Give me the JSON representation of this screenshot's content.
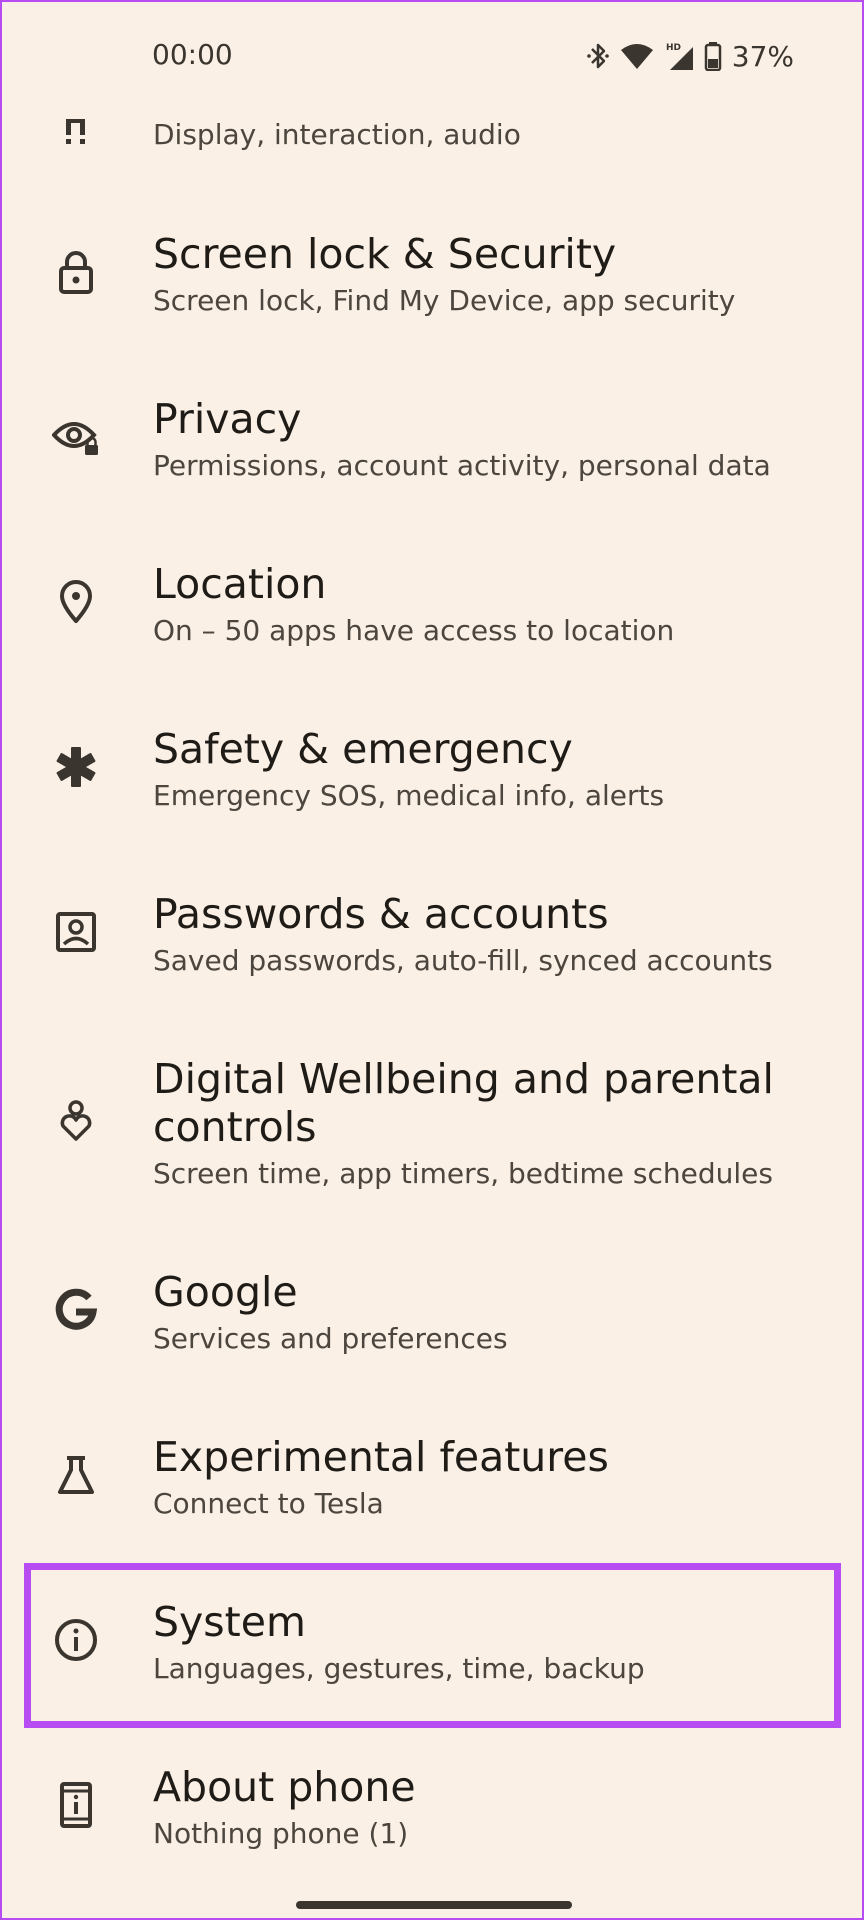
{
  "status_bar": {
    "time": "00:00",
    "battery_percent": "37%",
    "icons": [
      "bluetooth-icon",
      "wifi-icon",
      "hd-signal-icon",
      "battery-icon"
    ],
    "hd_label": "HD"
  },
  "items": [
    {
      "id": "accessibility",
      "title": "",
      "subtitle": "Display, interaction, audio",
      "icon": "accessibility-icon"
    },
    {
      "id": "screen-lock-security",
      "title": "Screen lock & Security",
      "subtitle": "Screen lock, Find My Device, app security",
      "icon": "lock-icon"
    },
    {
      "id": "privacy",
      "title": "Privacy",
      "subtitle": "Permissions, account activity, personal data",
      "icon": "privacy-eye-icon"
    },
    {
      "id": "location",
      "title": "Location",
      "subtitle": "On – 50 apps have access to location",
      "icon": "location-pin-icon"
    },
    {
      "id": "safety-emergency",
      "title": "Safety & emergency",
      "subtitle": "Emergency SOS, medical info, alerts",
      "icon": "asterisk-icon"
    },
    {
      "id": "passwords-accounts",
      "title": "Passwords & accounts",
      "subtitle": "Saved passwords, auto-fill, synced accounts",
      "icon": "account-box-icon"
    },
    {
      "id": "digital-wellbeing",
      "title_line1": "Digital Wellbeing and parental",
      "title_line2": "controls",
      "subtitle": "Screen time, app timers, bedtime schedules",
      "icon": "wellbeing-icon"
    },
    {
      "id": "google",
      "title": "Google",
      "subtitle": "Services and preferences",
      "icon": "google-g-icon"
    },
    {
      "id": "experimental-features",
      "title": "Experimental features",
      "subtitle": "Connect to Tesla",
      "icon": "flask-icon"
    },
    {
      "id": "system",
      "title": "System",
      "subtitle": "Languages, gestures, time, backup",
      "icon": "info-icon",
      "highlighted": true
    },
    {
      "id": "about-phone",
      "title": "About phone",
      "subtitle": "Nothing phone (1)",
      "icon": "phone-info-icon"
    }
  ],
  "colors": {
    "background": "#faf0e6",
    "highlight": "#b74cf2",
    "text_primary": "#1f1b16",
    "text_secondary": "#4c463e",
    "icon": "#3a352e"
  }
}
